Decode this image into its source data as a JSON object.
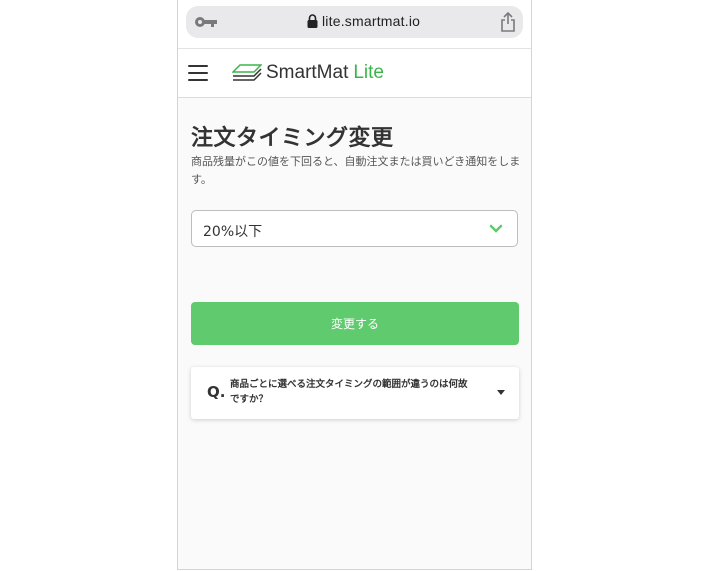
{
  "browser": {
    "url": "lite.smartmat.io"
  },
  "header": {
    "logo_main": "SmartMat",
    "logo_sub": "Lite"
  },
  "page": {
    "title": "注文タイミング変更",
    "description": "商品残量がこの値を下回ると、自動注文または買いどき通知をします。"
  },
  "form": {
    "threshold_value": "20%以下",
    "submit_label": "変更する"
  },
  "faq": {
    "prefix": "Q.",
    "question": "商品ごとに選べる注文タイミングの範囲が違うのは何故ですか？"
  },
  "colors": {
    "accent": "#5fcb6e",
    "logo_green": "#3bb54a"
  }
}
